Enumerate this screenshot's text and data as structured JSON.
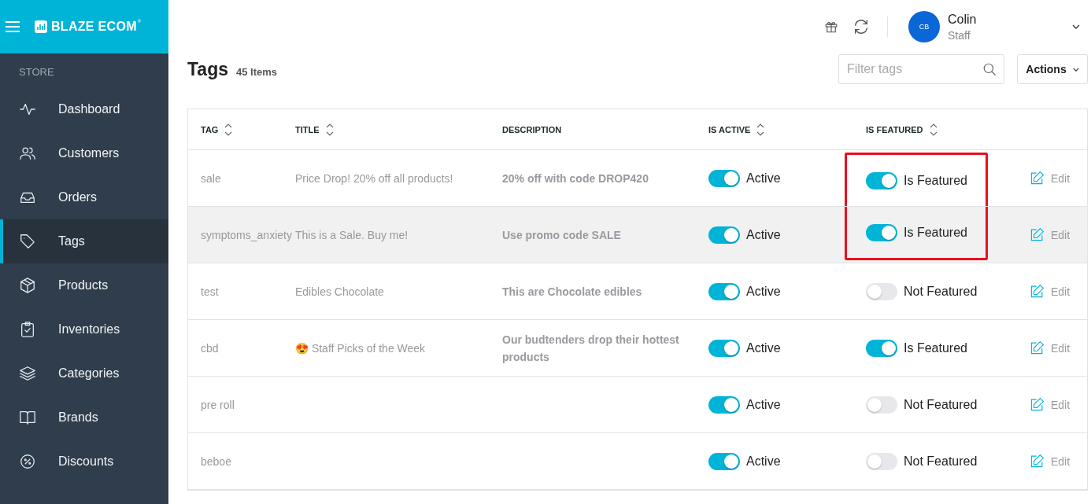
{
  "brand": {
    "name": "BLAZE ECOM",
    "mark": "®"
  },
  "sidebar": {
    "section": "STORE",
    "items": [
      {
        "label": "Dashboard",
        "selected": false
      },
      {
        "label": "Customers",
        "selected": false
      },
      {
        "label": "Orders",
        "selected": false
      },
      {
        "label": "Tags",
        "selected": true
      },
      {
        "label": "Products",
        "selected": false
      },
      {
        "label": "Inventories",
        "selected": false
      },
      {
        "label": "Categories",
        "selected": false
      },
      {
        "label": "Brands",
        "selected": false
      },
      {
        "label": "Discounts",
        "selected": false
      }
    ]
  },
  "user": {
    "initials": "CB",
    "name": "Colin",
    "role": "Staff"
  },
  "page": {
    "title": "Tags",
    "count": "45 Items"
  },
  "filter": {
    "placeholder": "Filter tags"
  },
  "actions_button": "Actions",
  "table": {
    "columns": [
      {
        "label": "TAG",
        "sortable": true
      },
      {
        "label": "TITLE",
        "sortable": true
      },
      {
        "label": "DESCRIPTION",
        "sortable": false
      },
      {
        "label": "IS ACTIVE",
        "sortable": true
      },
      {
        "label": "IS FEATURED",
        "sortable": true
      }
    ],
    "rows": [
      {
        "tag": "sale",
        "title": "Price Drop! 20% off all products!",
        "description": "20% off with code DROP420",
        "active": true,
        "active_label": "Active",
        "featured": true,
        "featured_label": "Is Featured",
        "edit": "Edit",
        "selected": false,
        "highlighted": true
      },
      {
        "tag": "symptoms_anxiety",
        "title": "This is a Sale. Buy me!",
        "description": "Use promo code SALE",
        "active": true,
        "active_label": "Active",
        "featured": true,
        "featured_label": "Is Featured",
        "edit": "Edit",
        "selected": true,
        "highlighted": true
      },
      {
        "tag": "test",
        "title": "Edibles Chocolate",
        "description": "This are Chocolate edibles",
        "active": true,
        "active_label": "Active",
        "featured": false,
        "featured_label": "Not Featured",
        "edit": "Edit",
        "selected": false,
        "highlighted": false
      },
      {
        "tag": "cbd",
        "title": "😍 Staff Picks of the Week",
        "description": "Our budtenders drop their hottest products",
        "active": true,
        "active_label": "Active",
        "featured": true,
        "featured_label": "Is Featured",
        "edit": "Edit",
        "selected": false,
        "highlighted": false
      },
      {
        "tag": "pre roll",
        "active": true,
        "active_label": "Active",
        "featured": false,
        "featured_label": "Not Featured",
        "edit": "Edit",
        "selected": false,
        "highlighted": false
      },
      {
        "tag": "beboe",
        "active": true,
        "active_label": "Active",
        "featured": false,
        "featured_label": "Not Featured",
        "edit": "Edit",
        "selected": false,
        "highlighted": false
      }
    ]
  }
}
